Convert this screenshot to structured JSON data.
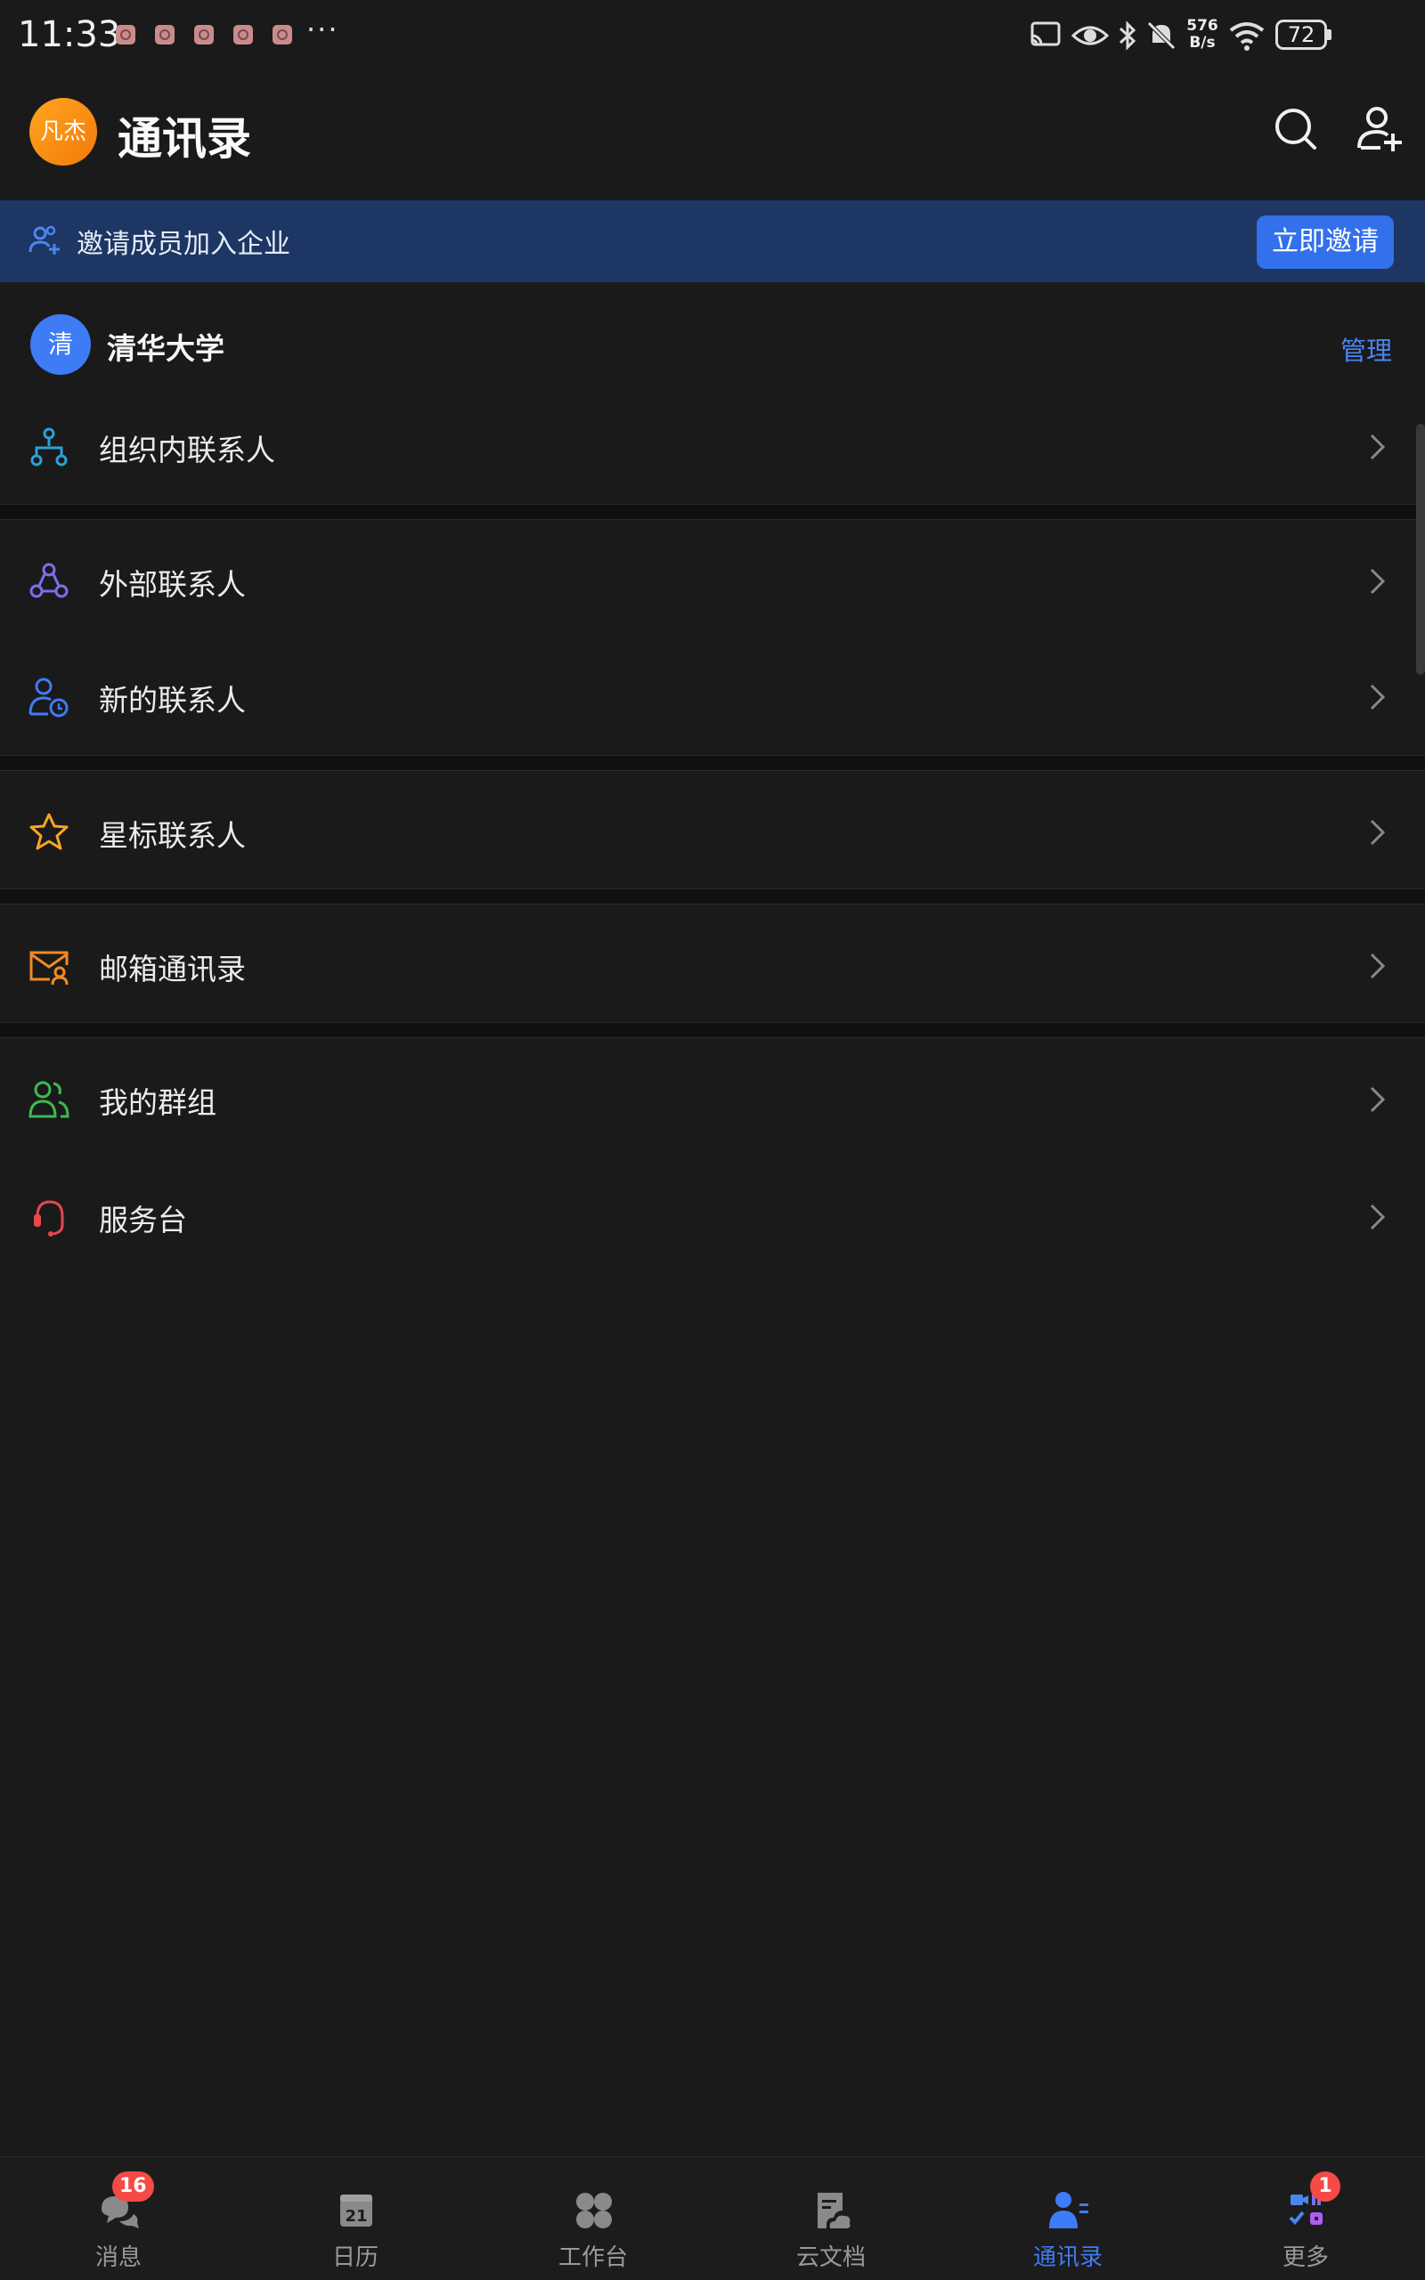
{
  "status_bar": {
    "time": "11:33",
    "more": "···",
    "net_speed_value": "576",
    "net_speed_unit": "B/s",
    "battery": "72"
  },
  "header": {
    "user_avatar_text": "凡杰",
    "title": "通讯录",
    "icons": [
      "search-icon",
      "add-contact-icon"
    ]
  },
  "invite_banner": {
    "text": "邀请成员加入企业",
    "button": "立即邀请",
    "background": "#1d3663",
    "button_color": "#3370eb"
  },
  "organization": {
    "avatar_text": "清",
    "name": "清华大学",
    "manage": "管理"
  },
  "contacts": [
    {
      "label": "组织内联系人",
      "icon": "org-tree-icon",
      "color": "#2aa1d8"
    },
    {
      "label": "外部联系人",
      "icon": "external-contacts-icon",
      "color": "#7b6ef0"
    },
    {
      "label": "新的联系人",
      "icon": "new-contact-icon",
      "color": "#3d7cf5"
    },
    {
      "label": "星标联系人",
      "icon": "star-icon",
      "color": "#f5a623"
    },
    {
      "label": "邮箱通讯录",
      "icon": "mail-contact-icon",
      "color": "#f08a24"
    },
    {
      "label": "我的群组",
      "icon": "group-icon",
      "color": "#3fb950"
    },
    {
      "label": "服务台",
      "icon": "headset-icon",
      "color": "#e5484d"
    }
  ],
  "tabs": [
    {
      "label": "消息",
      "icon": "chat-icon",
      "badge": "16"
    },
    {
      "label": "日历",
      "icon": "calendar-icon",
      "icon_text": "21"
    },
    {
      "label": "工作台",
      "icon": "workplace-icon"
    },
    {
      "label": "云文档",
      "icon": "docs-icon"
    },
    {
      "label": "通讯录",
      "icon": "contacts-icon",
      "active": true
    },
    {
      "label": "更多",
      "icon": "more-apps-icon",
      "badge": "1"
    }
  ],
  "colors": {
    "background": "#1a1a1a",
    "accent": "#3d7cf5",
    "badge": "#f54a45"
  }
}
